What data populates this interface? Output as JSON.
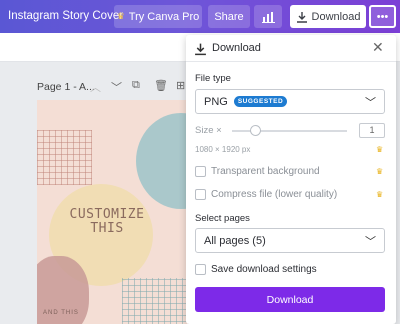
{
  "topbar": {
    "doc_title": "Instagram Story Cover",
    "try_label": "Try Canva Pro",
    "share_label": "Share",
    "download_label": "Download",
    "more_label": "•••"
  },
  "page_row": {
    "label": "Page 1 - A..."
  },
  "canvas": {
    "headline_line1": "CUSTOMIZE",
    "headline_line2": "THIS",
    "footer_text": "AND THIS"
  },
  "panel": {
    "title": "Download",
    "file_type_label": "File type",
    "file_type_value": "PNG",
    "file_type_badge": "SUGGESTED",
    "size_label": "Size ×",
    "size_value": "1",
    "dimensions": "1080 × 1920 px",
    "transparent_label": "Transparent background",
    "compress_label": "Compress file (lower quality)",
    "select_pages_label": "Select pages",
    "pages_value": "All pages (5)",
    "save_settings_label": "Save download settings",
    "download_button": "Download"
  },
  "colors": {
    "accent": "#7d2ae8",
    "badge": "#1d7bd1",
    "crown": "#e8b21b"
  }
}
